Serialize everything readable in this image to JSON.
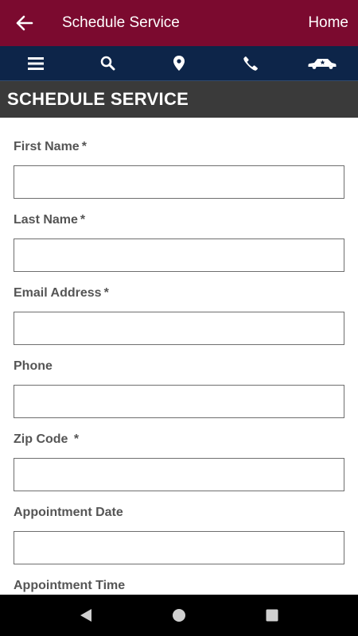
{
  "appbar": {
    "title": "Schedule Service",
    "home_label": "Home"
  },
  "navbar": {
    "icons": [
      "menu-icon",
      "search-icon",
      "location-pin-icon",
      "phone-icon",
      "car-icon"
    ]
  },
  "section": {
    "title": "SCHEDULE SERVICE"
  },
  "form": {
    "fields": [
      {
        "label": "First Name",
        "required": "*",
        "value": ""
      },
      {
        "label": "Last Name",
        "required": "*",
        "value": ""
      },
      {
        "label": "Email Address",
        "required": "*",
        "value": ""
      },
      {
        "label": "Phone",
        "required": "",
        "value": ""
      },
      {
        "label": "Zip Code ",
        "required": "*",
        "value": ""
      },
      {
        "label": "Appointment Date",
        "required": "",
        "value": ""
      },
      {
        "label": "Appointment Time",
        "required": "",
        "value": ""
      }
    ]
  },
  "system_nav": {
    "icons": [
      "back-triangle-icon",
      "home-circle-icon",
      "recents-square-icon"
    ]
  },
  "colors": {
    "appbar": "#7b0a2f",
    "navbar": "#0d2549",
    "section_header": "#3a3a3a",
    "label": "#555555"
  }
}
